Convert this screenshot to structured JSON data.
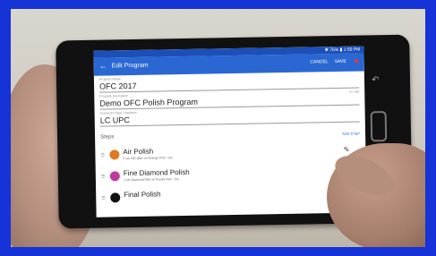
{
  "status": {
    "text": "✱ 76% ▮ 1:59 PM"
  },
  "appbar": {
    "title": "Edit Program",
    "cancel": "CANCEL",
    "save": "SAVE"
  },
  "fields": {
    "program_name": {
      "label": "Program Name",
      "value": "OFC 2017"
    },
    "program_description": {
      "label": "Program Description",
      "value": "Demo OFC Polish Program",
      "count": "0 / 100"
    },
    "connector_type": {
      "label": "Connector Type / Interface",
      "value": "LC UPC"
    }
  },
  "steps": {
    "label": "Steps",
    "add": "ADD STEP",
    "items": [
      {
        "name": "Air Polish",
        "sub": "5 um SiC fiber on Orange Pad - Dry",
        "color": "#e07a1f"
      },
      {
        "name": "Fine Diamond Polish",
        "sub": "1 um Diamond Film on Purple Pad - Dry",
        "color": "#c2399e"
      },
      {
        "name": "Final Polish",
        "sub": "",
        "color": "#111111"
      }
    ]
  }
}
